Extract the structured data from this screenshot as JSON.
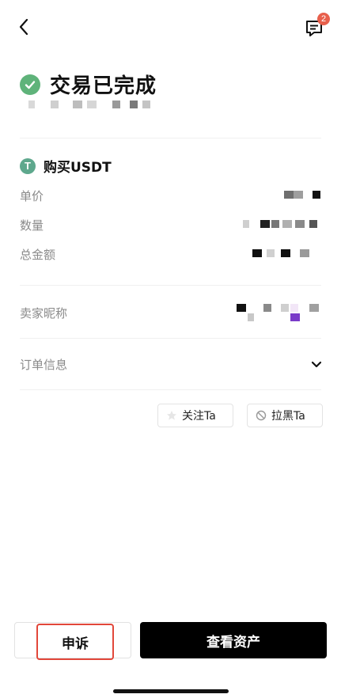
{
  "nav": {
    "back_icon": "chevron-left-icon",
    "chat_icon": "message-icon",
    "chat_badge_count": "2"
  },
  "status": {
    "title": "交易已完成",
    "check_icon": "check-circle-icon",
    "check_color": "#5fb37a"
  },
  "order": {
    "coin_icon": "tether-icon",
    "coin_symbol": "T",
    "coin_title": "购买USDT",
    "fields": [
      {
        "label": "单价"
      },
      {
        "label": "数量"
      },
      {
        "label": "总金额"
      }
    ],
    "seller_label": "卖家昵称",
    "order_info_label": "订单信息",
    "order_info_icon": "chevron-down-icon"
  },
  "actions": {
    "follow_label": "关注Ta",
    "follow_icon": "star-icon",
    "block_label": "拉黑Ta",
    "block_icon": "block-icon"
  },
  "bottom": {
    "appeal_label": "申诉",
    "view_assets_label": "查看资产",
    "highlight_color": "#e2473a"
  }
}
